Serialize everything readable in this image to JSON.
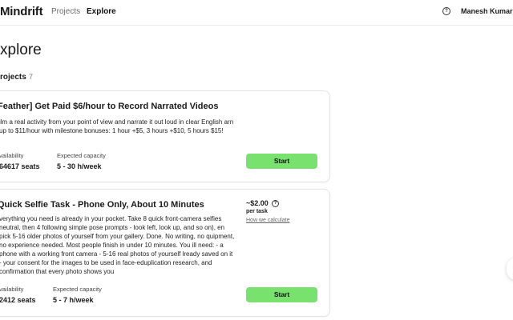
{
  "header": {
    "logo": "Mindrift",
    "nav": [
      {
        "label": "Projects"
      },
      {
        "label": "Explore"
      }
    ],
    "help_icon": "help-circle-icon",
    "user_name": "Manesh Kumar"
  },
  "page": {
    "title": "xplore",
    "section_label": "rojects",
    "section_count": "7"
  },
  "cards": [
    {
      "title": "Feather] Get Paid $6/hour to Record Narrated Videos",
      "description": "ilm a real activity from your point of view and narrate it out loud in clear English arn up to $11/hour with milestone bonuses: 1 hour +$5, 3 hours +$10, 5 hours $15!",
      "availability_label": "vailability",
      "availability_value": "64617 seats",
      "capacity_label": "Expected capacity",
      "capacity_value": "5 - 30 h/week",
      "button": "Start"
    },
    {
      "title": "Quick Selfie Task - Phone Only, About 10 Minutes",
      "description": "verything you need is already in your pocket. Take 8 quick front-camera selfies neutral, then 4 following simple pose prompts - look left, look up, and so on), en pick 5-16 older photos of yourself from your gallery. Done. No writing, no quipment, no experience needed. Most people finish in under 10 minutes. You ill need: - a phone with a working front camera - 5-16 real photos of yourself lready saved on it - your consent for the images to be used in face-eduplication research, and confirmation that every photo shows you",
      "price": "~$2.00",
      "price_unit": "per task",
      "price_link": "How we calculate",
      "price_icon": "info-circle-icon",
      "availability_label": "vailability",
      "availability_value": "2412 seats",
      "capacity_label": "Expected capacity",
      "capacity_value": "5 - 7 h/week",
      "button": "Start"
    }
  ],
  "colors": {
    "accent_button": "#79e26f",
    "border": "#e3e3e3"
  }
}
